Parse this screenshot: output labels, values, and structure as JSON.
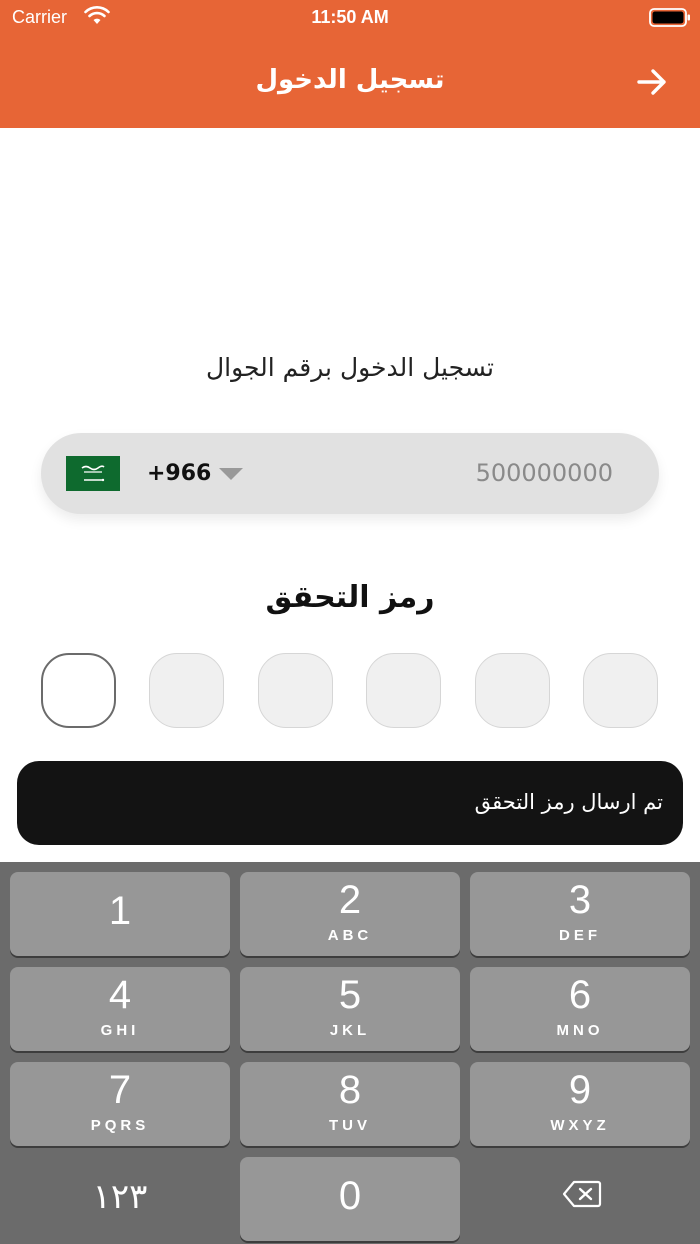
{
  "status_bar": {
    "carrier": "Carrier",
    "time": "11:50 AM"
  },
  "nav": {
    "title": "تسجيل الدخول",
    "back_icon": "arrow-right-icon"
  },
  "login": {
    "heading": "تسجيل الدخول برقم الجوال",
    "country_code": "+966",
    "phone_placeholder": "500000000",
    "flag": "saudi-arabia-flag-icon"
  },
  "otp": {
    "title": "رمز التحقق",
    "length": 6
  },
  "toast": {
    "message": "تم ارسال رمز التحقق"
  },
  "keyboard": {
    "keys": [
      {
        "num": "1",
        "letters": ""
      },
      {
        "num": "2",
        "letters": "ABC"
      },
      {
        "num": "3",
        "letters": "DEF"
      },
      {
        "num": "4",
        "letters": "GHI"
      },
      {
        "num": "5",
        "letters": "JKL"
      },
      {
        "num": "6",
        "letters": "MNO"
      },
      {
        "num": "7",
        "letters": "PQRS"
      },
      {
        "num": "8",
        "letters": "TUV"
      },
      {
        "num": "9",
        "letters": "WXYZ"
      },
      {
        "num": "١٢٣",
        "letters": ""
      },
      {
        "num": "0",
        "letters": ""
      }
    ],
    "delete_icon": "backspace-icon"
  },
  "colors": {
    "brand": "#e76536",
    "toast_bg": "#131313",
    "keyboard_bg": "#6b6b6b",
    "key_bg": "#979797"
  }
}
